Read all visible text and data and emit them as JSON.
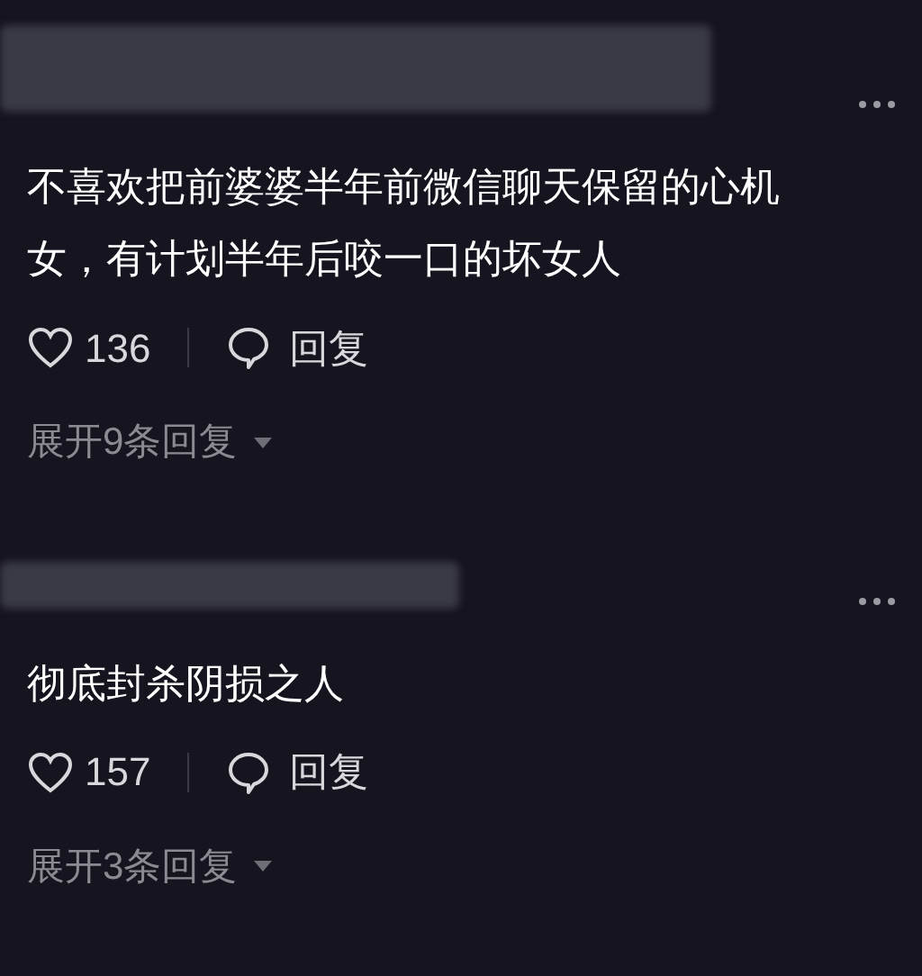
{
  "comments": [
    {
      "text": "不喜欢把前婆婆半年前微信聊天保留的心机女，有计划半年后咬一口的坏女人",
      "likes": "136",
      "reply": "回复",
      "expand": "展开9条回复"
    },
    {
      "text": "彻底封杀阴损之人",
      "likes": "157",
      "reply": "回复",
      "expand": "展开3条回复"
    }
  ]
}
